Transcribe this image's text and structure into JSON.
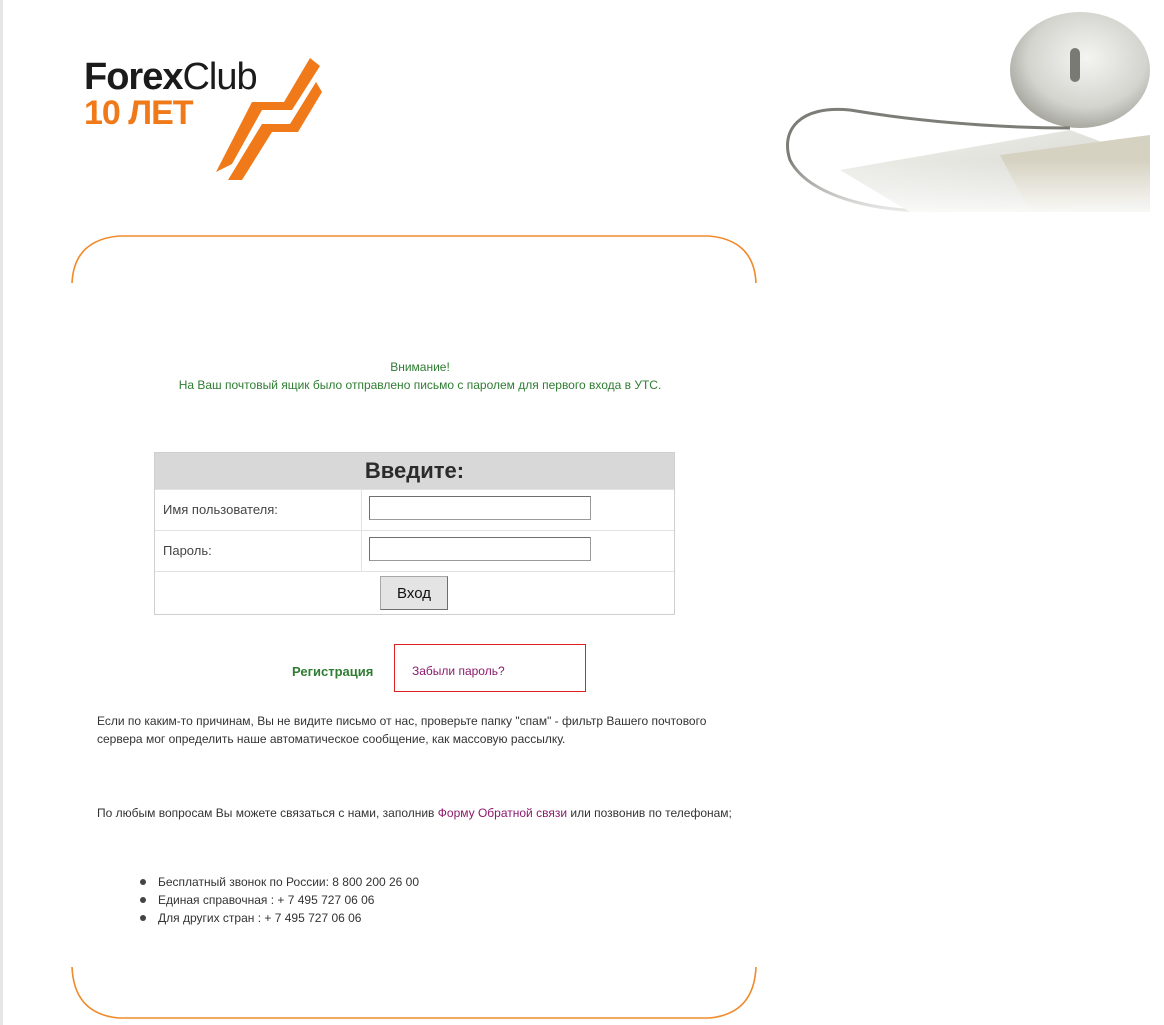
{
  "brand": {
    "logo_name": "ForexClub",
    "logo_forex": "Forex",
    "logo_club": "Club",
    "logo_years": "10 ЛЕТ",
    "accent_color": "#f07a1a"
  },
  "notice": {
    "title": "Внимание!",
    "body": "На Ваш почтовый ящик было отправлено письмо с паролем для первого входа в УТС."
  },
  "login_form": {
    "heading": "Введите:",
    "username_label": "Имя пользователя:",
    "username_value": "",
    "password_label": "Пароль:",
    "password_value": "",
    "submit_label": "Вход"
  },
  "links": {
    "register": "Регистрация",
    "forgot_password": "Забыли пароль?"
  },
  "info": {
    "spam_note": "Если по каким-то причинам, Вы не видите письмо от нас, проверьте папку \"спам\" - фильтр Вашего почтового сервера мог определить наше автоматическое сообщение, как массовую рассылку.",
    "contact_intro": "По любым вопросам Вы можете связаться с нами, заполнив",
    "feedback_link": "Форму Обратной связи",
    "contact_outro": "или позвонив по телефонам;",
    "phones": [
      "Бесплатный звонок по России: 8 800 200 26 00",
      "Единая справочная : + 7 495 727 06 06",
      "Для других стран : + 7 495 727 06 06"
    ]
  }
}
